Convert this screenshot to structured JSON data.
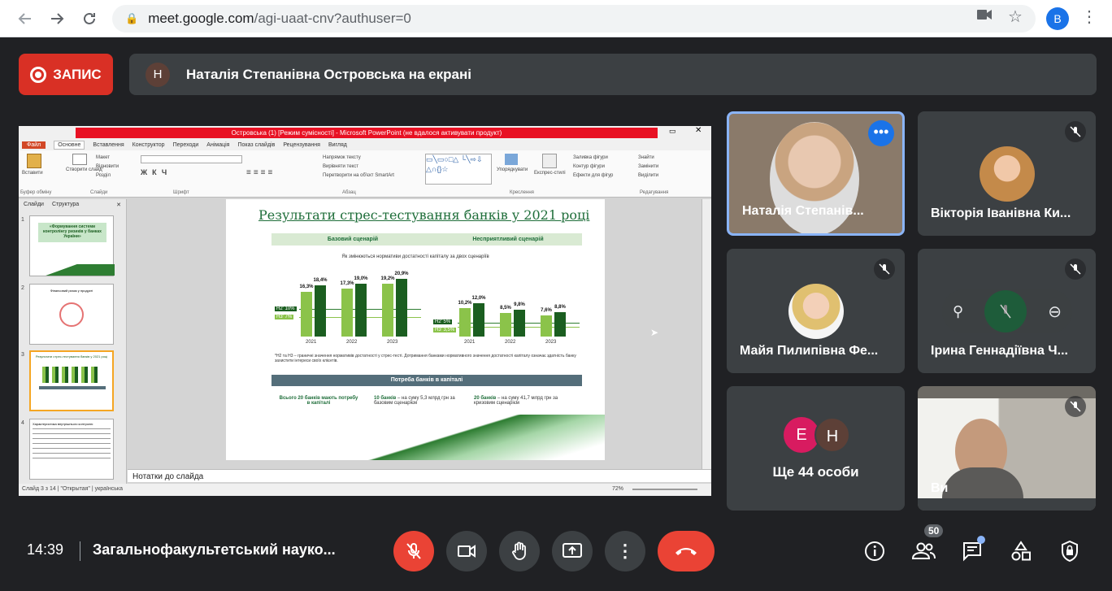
{
  "browser": {
    "url_host": "meet.google.com",
    "url_path": "/agi-uaat-cnv?authuser=0",
    "profile_initial": "B",
    "back_icon": "arrow-left-icon",
    "forward_icon": "arrow-right-icon",
    "reload_icon": "reload-icon"
  },
  "record": {
    "label": "ЗАПИС"
  },
  "presenting": {
    "initial": "Н",
    "text": "Наталія Степанівна Островська на екрані"
  },
  "ppt": {
    "title": "Островська (1) [Режим сумісності] - Microsoft PowerPoint (не вдалося активувати продукт)",
    "tabs": [
      "Файл",
      "Основне",
      "Вставлення",
      "Конструктор",
      "Переходи",
      "Анімація",
      "Показ слайдів",
      "Рецензування",
      "Вигляд"
    ],
    "groups": [
      "Буфер обміну",
      "Слайди",
      "Шрифт",
      "Абзац",
      "Креслення",
      "Редагування"
    ],
    "ribbon": {
      "paste": "Вставити",
      "new_slide": "Створити слайд",
      "layout": "Макет",
      "reset": "Відновити",
      "section": "Розділ",
      "text_dir": "Напрямок тексту",
      "align_text": "Вирівняти текст",
      "smartart": "Перетворити на об'єкт SmartArt",
      "arrange": "Упорядкувати",
      "quick_styles": "Експрес-стилі",
      "shape_fill": "Заливка фігури",
      "shape_outline": "Контур фігури",
      "shape_effects": "Ефекти для фігур",
      "find": "Знайти",
      "replace": "Замінити",
      "select": "Виділити"
    },
    "pane_tabs": [
      "Слайди",
      "Структура"
    ],
    "thumbs": [
      {
        "num": "1",
        "text": "«Формування системи контролінгу ризиків у банках України»"
      },
      {
        "num": "2",
        "text": "Фінансовий ризик у продукті"
      },
      {
        "num": "3",
        "text": "Результати стрес-тестування банків у 2021 році"
      },
      {
        "num": "4",
        "text": "Характеристика внутрішнього контролю"
      }
    ],
    "notes": "Нотатки до слайда",
    "status_slide": "Слайд 3 з 14",
    "status_theme": "\"Открытая\"",
    "status_lang": "українська",
    "zoom": "72%"
  },
  "slide": {
    "title": "Результати стрес-тестування банків у 2021 році",
    "base_label": "Базовий сценарій",
    "adverse_label": "Несприятливий сценарій",
    "subtitle": "Як змінюються нормативи достатності капіталу за двох сценаріїв",
    "thr_n2": "Н2' 10%",
    "thr_n3": "Н3' 7%",
    "thr_n2b": "Н2' 5%",
    "thr_n3b": "Н3' 3,5%",
    "footnote": "*Н2 та Н3 – граничні значення нормативів достатності у стрес-тесті. Дотримання банками нормативного значення достатності капіталу означає здатність банку захистити інтереси своїх клієнтів.",
    "banner": "Потреба банків в капіталі",
    "col1": "Всього 20 банків мають потребу в капіталі",
    "col2_bold": "10 банків",
    "col2": " – на суму 5,3 млрд грн за базовим сценарієм",
    "col3_bold": "20 банків",
    "col3": " – на суму 41,7 млрд грн за кризовим сценарієм"
  },
  "chart_data": [
    {
      "type": "bar",
      "title": "Базовий сценарій",
      "categories": [
        "2021",
        "2022",
        "2023"
      ],
      "series": [
        {
          "name": "Н3",
          "values": [
            16.3,
            17.3,
            19.2
          ]
        },
        {
          "name": "Н2",
          "values": [
            18.4,
            19.0,
            20.9
          ]
        }
      ],
      "labels": [
        "16,3%",
        "18,4%",
        "17,3%",
        "19,0%",
        "19,2%",
        "20,9%"
      ],
      "ylim": [
        0,
        22
      ],
      "thresholds": [
        10,
        7
      ],
      "colors": [
        "#8bc34a",
        "#1b5e20"
      ]
    },
    {
      "type": "bar",
      "title": "Несприятливий сценарій",
      "categories": [
        "2021",
        "2022",
        "2023"
      ],
      "series": [
        {
          "name": "Н3",
          "values": [
            10.2,
            8.5,
            7.6
          ]
        },
        {
          "name": "Н2",
          "values": [
            12.0,
            9.8,
            8.8
          ]
        }
      ],
      "labels": [
        "10,2%",
        "12,0%",
        "8,5%",
        "9,8%",
        "7,6%",
        "8,8%"
      ],
      "ylim": [
        0,
        22
      ],
      "thresholds": [
        5,
        3.5
      ],
      "colors": [
        "#8bc34a",
        "#1b5e20"
      ]
    }
  ],
  "participants": [
    {
      "name": "Наталія Степанівна Островська",
      "short": "Наталія Степанів...",
      "kind": "video",
      "icon": "more-options-icon"
    },
    {
      "name": "Вікторія Іванівна Ки...",
      "kind": "avatar",
      "muted": true
    },
    {
      "name": "Майя Пилипівна Фе...",
      "kind": "avatar",
      "muted": true
    },
    {
      "name": "Ірина Геннадіївна Ч...",
      "kind": "avatar",
      "muted": true
    },
    {
      "name": "Ще 44 особи",
      "kind": "group",
      "initials": [
        "Е",
        "Н"
      ]
    },
    {
      "name": "Ви",
      "kind": "video",
      "muted": true
    }
  ],
  "bottom": {
    "time": "14:39",
    "meeting": "Загальнофакультетський науко...",
    "people_count": "50",
    "buttons": [
      "mic-off-icon",
      "camera-icon",
      "raise-hand-icon",
      "present-icon",
      "more-icon",
      "end-call-icon"
    ],
    "right_icons": [
      "info-icon",
      "people-icon",
      "chat-icon",
      "activities-icon",
      "host-controls-icon"
    ]
  }
}
